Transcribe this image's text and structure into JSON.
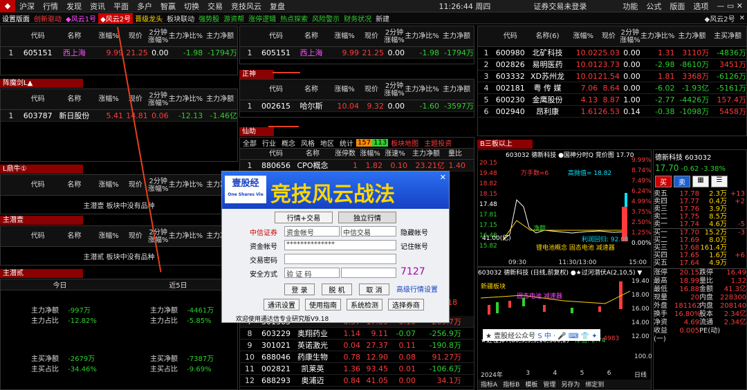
{
  "menu": {
    "items": [
      "沪深",
      "行情",
      "发现",
      "资讯",
      "平面",
      "多户",
      "智赢",
      "切换",
      "交易",
      "竞技风云",
      "复盘"
    ],
    "time": "11:26:44 周四",
    "notice": "证券交易未登录",
    "right": [
      "功能",
      "公式",
      "版面",
      "选项"
    ]
  },
  "tabs": {
    "items": [
      "设置版面",
      "创新驱动",
      "◆风云1号",
      "◆风云2号",
      "晋级龙头",
      "板块联动",
      "强势股",
      "游资帮",
      "涨停逻辑",
      "热点探索",
      "风险警示",
      "财务状况",
      "新建"
    ],
    "right": "◆风云2号"
  },
  "cols": {
    "code": "代码",
    "name": "名称",
    "chg": "涨幅%",
    "price": "现价",
    "min2": "2分钟涨幅%",
    "netpct": "主力净比%",
    "net": "主力净额",
    "name6": "名称(6)",
    "netbuy": "主买净额"
  },
  "p1": {
    "rows": [
      [
        "1",
        "605151",
        "西上海",
        "9.99",
        "21.25",
        "0.00",
        "-1.98",
        "-1794万"
      ]
    ]
  },
  "p2": {
    "title": "阵魔剑L▲",
    "rows": [
      [
        "1",
        "603787",
        "新日股份",
        "5.41",
        "14.81",
        "0.06",
        "-12.13",
        "-1.46亿"
      ]
    ]
  },
  "p3": {
    "title": "L鼎牛①",
    "msg": "主潜壹 板块中没有品种"
  },
  "p4": {
    "title": "主潜壹",
    "msg": "主潜贰 板块中没有品种"
  },
  "p5": {
    "title": "主潜贰",
    "today": "今日",
    "d5": "近5日",
    "l1": "主力净额",
    "l2": "主力占比",
    "l3": "主买净额",
    "l4": "主买占比",
    "t1": "-997万",
    "t2": "-12.82%",
    "t3": "-2679万",
    "t4": "-34.46%",
    "f1": "-4461万",
    "f2": "-5.85%",
    "f3": "-7387万",
    "f4": "-9.69%"
  },
  "mid1": {
    "rows": [
      [
        "1",
        "605151",
        "西上海",
        "9.99",
        "21.25",
        "0.00",
        "-1.98",
        "-1794万"
      ]
    ]
  },
  "mid2": {
    "title": "正神",
    "rows": [
      [
        "1",
        "002615",
        "哈尔斯",
        "10.04",
        "9.32",
        "0.00",
        "-1.60",
        "-3597万"
      ]
    ]
  },
  "mid3": {
    "title": "仙助",
    "tabs": [
      "全部",
      "行业",
      "概念",
      "风格",
      "地区",
      "统计"
    ],
    "b1": "157",
    "b2": "113",
    "links": [
      "板块地图",
      "主题投资"
    ],
    "h": [
      "代码",
      "名称",
      "涨停数",
      "涨幅%",
      "涨速%",
      "主力净额",
      "量比"
    ],
    "rows": [
      [
        "1",
        "880656",
        "CPO概念",
        "1",
        "1.82",
        "0.10",
        "23.21亿",
        "1.40"
      ]
    ],
    "rows2": [
      [
        "7",
        "301365",
        "",
        "0.57",
        "17.09",
        "0.10",
        "269.7万"
      ],
      [
        "8",
        "603229",
        "奥翔药业",
        "1.14",
        "9.11",
        "-0.07",
        "-256.9万"
      ],
      [
        "9",
        "301021",
        "英诺激光",
        "0.04",
        "27.37",
        "0.11",
        "-190.8万"
      ],
      [
        "10",
        "688046",
        "药康生物",
        "0.78",
        "12.90",
        "0.08",
        "91.27万"
      ],
      [
        "11",
        "002821",
        "凯莱英",
        "1.36",
        "93.45",
        "0.01",
        "-106.6万"
      ],
      [
        "12",
        "688293",
        "奥浦迈",
        "0.84",
        "41.05",
        "0.00",
        "34.1万"
      ]
    ],
    "sideVals": [
      "18"
    ]
  },
  "right": {
    "rows": [
      [
        "1",
        "600980",
        "北矿科技",
        "10.02",
        "25.03",
        "0.00",
        "1.31",
        "3110万",
        "-4836万"
      ],
      [
        "2",
        "002826",
        "易明医药",
        "10.01",
        "23.73",
        "0.00",
        "-2.98",
        "-8610万",
        "3451万"
      ],
      [
        "3",
        "603332",
        "XD苏州龙",
        "10.01",
        "21.54",
        "0.00",
        "1.81",
        "3368万",
        "-6126万"
      ],
      [
        "4",
        "002181",
        "粤 传 媒",
        "7.06",
        "8.64",
        "0.00",
        "-6.02",
        "-1.93亿",
        "-5161万"
      ],
      [
        "5",
        "600230",
        "金鹰股份",
        "4.13",
        "8.87",
        "1.00",
        "-2.77",
        "-4426万",
        "157.4万"
      ],
      [
        "6",
        "002940",
        "昂利康",
        "1.61",
        "26.53",
        "0.14",
        "-0.38",
        "-1098万",
        "5458万"
      ]
    ],
    "title": "B三板以上"
  },
  "chart": {
    "title": "603032 德新科技 ●国神分时Q 竞价图 17.70",
    "ylabels": [
      "20.15",
      "19.48",
      "18.82",
      "18.15",
      "17.48",
      "17.81",
      "17.15",
      "16.48",
      "15.82"
    ],
    "pct": [
      "9.99%",
      "8.74%",
      "7.49%",
      "6.24%",
      "4.99%",
      "3.75%",
      "2.50%",
      "1.25%",
      "0.00%"
    ],
    "xlabels": [
      "09:30",
      "11:30/13:00",
      "15:00"
    ],
    "ann1": "万手数=6",
    "ann2": "高抛值= 18.82",
    "ann3": "净额",
    "ann4": "利润回归: 92.08",
    "ann5": "锂电池概念 固态电池 减速器",
    "ann6": "41.00(亿)"
  },
  "kline": {
    "title": "603032 德新科技 (日线,前复权) ●★过河潜伏A(2,10,5) ▼",
    "y": [
      "19.40",
      "18.00",
      "16.00",
      "14.00",
      "12.00"
    ],
    "a1": "新疆板块",
    "a2": "固态电池 减速器",
    "a3": "★近程弹T(80,5,5,5,10,300,2)",
    "a4": "净值:-2.74",
    "a5": "-4983",
    "a6": "100.0",
    "x": [
      "2024年",
      "3",
      "4",
      "5",
      "6",
      "日线"
    ],
    "bottom": [
      "指标A",
      "指标B",
      "模板",
      "管理",
      "另存为",
      "绑定到"
    ]
  },
  "quote": {
    "name": "德新科技 603032",
    "price": "17.70",
    "chg": "-0.62",
    "pct": "-3.38%",
    "btns": [
      "买",
      "卖",
      "",
      "",
      ""
    ],
    "sells": [
      [
        "卖五",
        "17.78",
        "2.3万",
        "+13"
      ],
      [
        "卖四",
        "17.77",
        "0.4万",
        "+2"
      ],
      [
        "卖三",
        "17.76",
        "3.9万",
        ""
      ],
      [
        "卖二",
        "17.75",
        "8.5万",
        ""
      ],
      [
        "卖一",
        "17.74",
        "4.6万",
        "-5"
      ]
    ],
    "buys": [
      [
        "买一",
        "17.70",
        "15.2万",
        "-3"
      ],
      [
        "买二",
        "17.69",
        "8.0万",
        ""
      ],
      [
        "买三",
        "17.68",
        "161.4万",
        ""
      ],
      [
        "买四",
        "17.65",
        "1.6万",
        "+6"
      ],
      [
        "买五",
        "17.64",
        "4.9万",
        ""
      ]
    ],
    "stats": [
      [
        "涨停",
        "20.15",
        "跌停",
        "16.49"
      ],
      [
        "最高",
        "18.99",
        "量比",
        "1.32"
      ],
      [
        "最低",
        "16.88",
        "金额",
        "41.3亿"
      ],
      [
        "现量",
        "20",
        "内盘",
        "228300"
      ],
      [
        "外盘",
        "181162",
        "内盘",
        "208140"
      ],
      [
        "换手",
        "16.80%",
        "股本",
        "2.34亿"
      ],
      [
        "净资",
        "4.69",
        "流通",
        "2.34亿"
      ],
      [
        "收益(一)",
        "0.005",
        "PE(动)",
        ""
      ]
    ]
  },
  "login": {
    "brand": "壹股经",
    "brandEn": "One Shares Vie",
    "title": "竞技风云战法",
    "tab1": "行情+交易",
    "tab2": "独立行情",
    "broker": "中信证券",
    "acct": "资金帐号",
    "trade": "中信交易",
    "hide": "隐藏帐号",
    "l1": "资金帐号",
    "val1": "**************",
    "remember": "记住帐号",
    "l2": "交易密码",
    "l3": "安全方式",
    "val3": "验 证 码",
    "code": "7127",
    "b1": "登 录",
    "b2": "脱 机",
    "b3": "取 消",
    "adv": "高级行情设置",
    "c1": "通讯设置",
    "c2": "使用指南",
    "c3": "系统检测",
    "c4": "选择券商",
    "footer": "欢迎使用通达信专业研究版V9.18"
  },
  "watermark": "★ 壹股经公众号"
}
